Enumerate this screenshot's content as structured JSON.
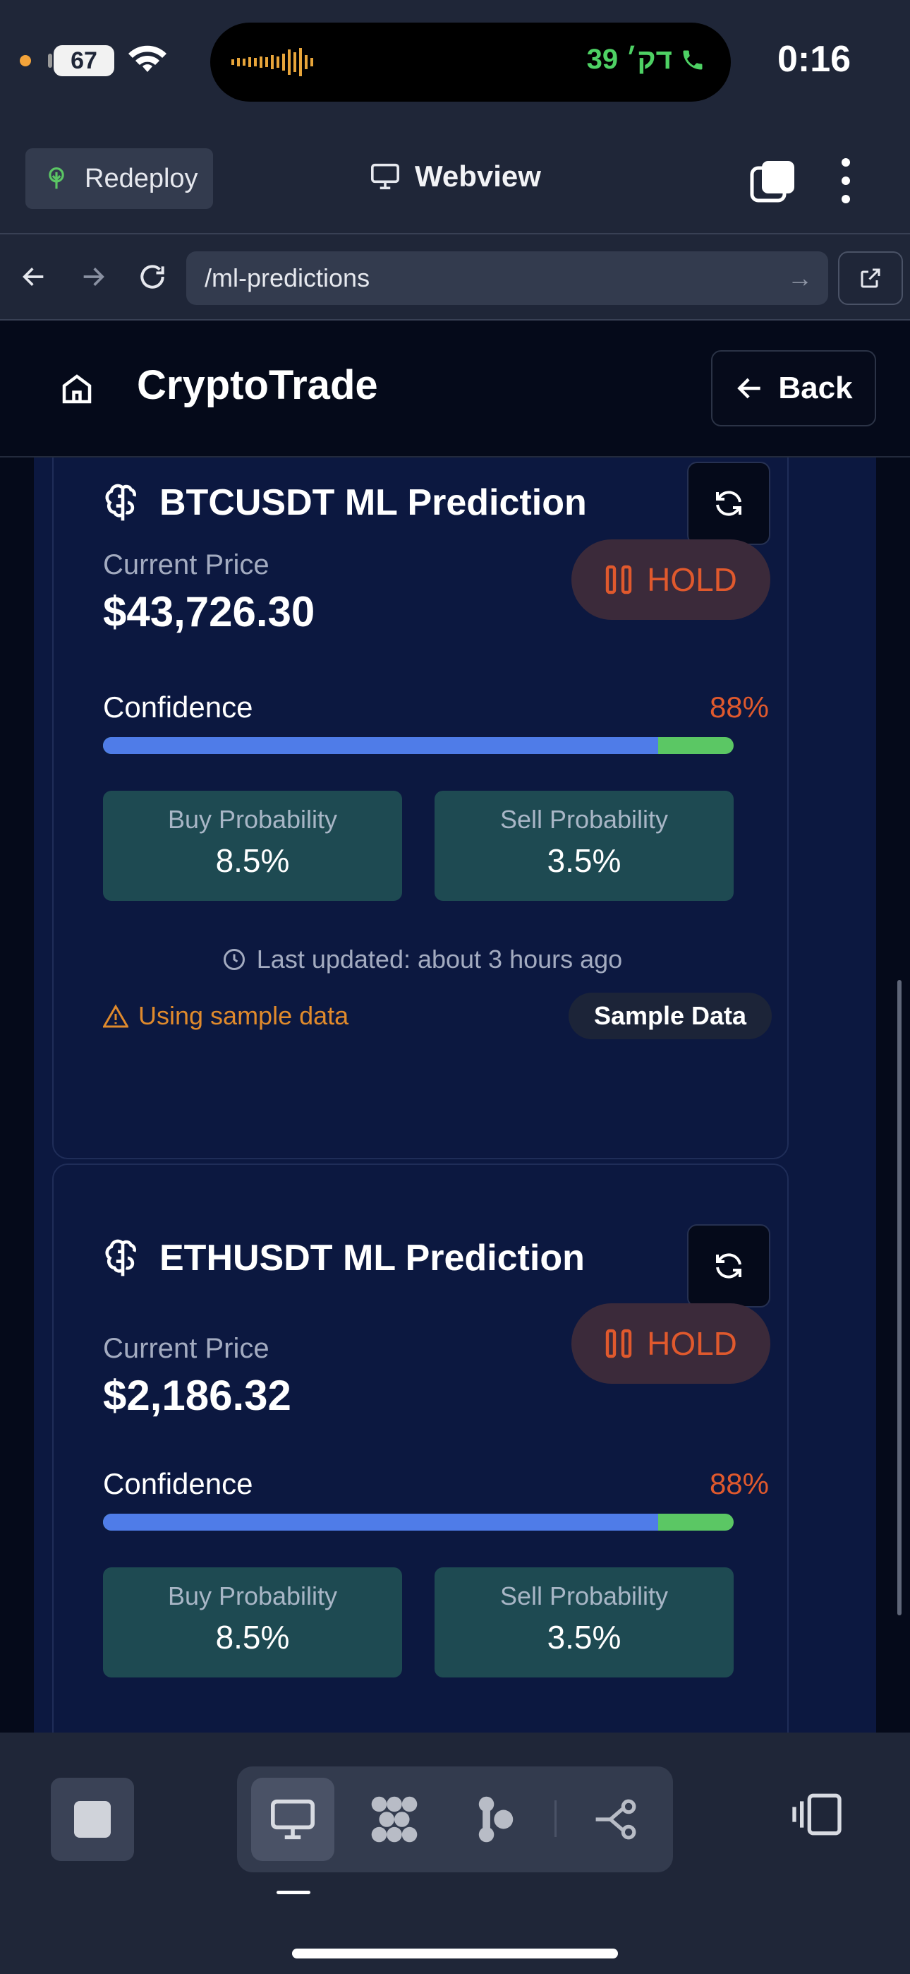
{
  "status_bar": {
    "battery": "67",
    "call_text": "39 דק׳",
    "time": "0:16"
  },
  "toolbar": {
    "redeploy_label": "Redeploy",
    "webview_label": "Webview"
  },
  "url_bar": {
    "url": "/ml-predictions"
  },
  "app_header": {
    "brand": "CryptoTrade",
    "back_label": "Back"
  },
  "predictions": [
    {
      "title": "BTCUSDT ML Prediction",
      "current_price_label": "Current Price",
      "current_price": "$43,726.30",
      "signal": "HOLD",
      "confidence_label": "Confidence",
      "confidence": "88%",
      "confidence_fraction": 0.88,
      "buy_label": "Buy Probability",
      "buy_value": "8.5%",
      "sell_label": "Sell Probability",
      "sell_value": "3.5%",
      "last_updated": "Last updated: about 3 hours ago",
      "sample_warning": "Using sample data",
      "sample_badge": "Sample Data"
    },
    {
      "title": "ETHUSDT ML Prediction",
      "current_price_label": "Current Price",
      "current_price": "$2,186.32",
      "signal": "HOLD",
      "confidence_label": "Confidence",
      "confidence": "88%",
      "confidence_fraction": 0.88,
      "buy_label": "Buy Probability",
      "buy_value": "8.5%",
      "sell_label": "Sell Probability",
      "sell_value": "3.5%"
    }
  ],
  "colors": {
    "accent_blue": "#4f7ce8",
    "accent_green": "#5bc764",
    "hold_orange": "#e0592d",
    "warning_orange": "#e08a2c"
  }
}
